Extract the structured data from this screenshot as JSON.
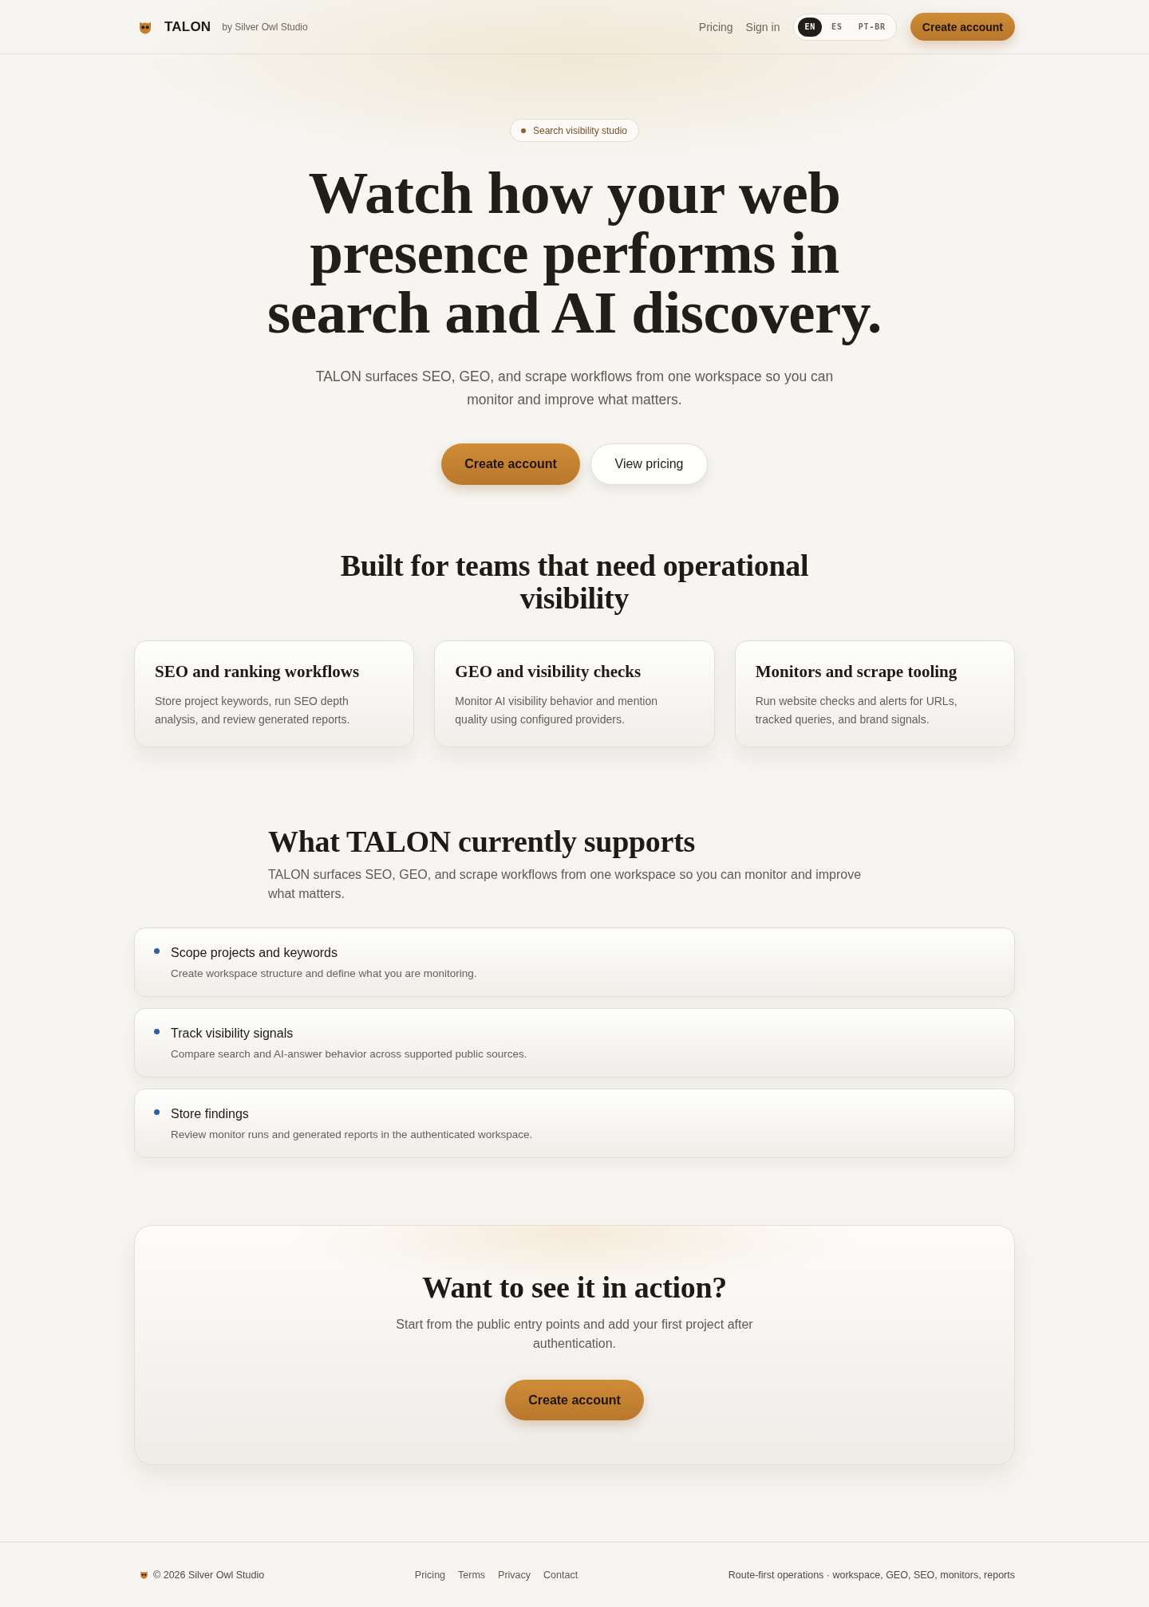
{
  "header": {
    "brand": "TALON",
    "byline": "by Silver Owl Studio",
    "nav_links": [
      "Pricing",
      "Sign in"
    ],
    "languages": [
      {
        "label": "EN",
        "selected": true
      },
      {
        "label": "ES",
        "selected": false
      },
      {
        "label": "PT-BR",
        "selected": false
      }
    ],
    "cta": "Create account"
  },
  "hero": {
    "badge": "Search visibility studio",
    "title": "Watch how your web presence performs in search and AI discovery.",
    "subtitle": "TALON surfaces SEO, GEO, and scrape workflows from one workspace so you can monitor and improve what matters.",
    "buttons": [
      {
        "label": "Create account",
        "kind": "primary"
      },
      {
        "label": "View pricing",
        "kind": "secondary"
      }
    ]
  },
  "features": {
    "heading": "Built for teams that need operational visibility",
    "cards": [
      {
        "title": "SEO and ranking workflows",
        "description": "Store project keywords, run SEO depth analysis, and review generated reports."
      },
      {
        "title": "GEO and visibility checks",
        "description": "Monitor AI visibility behavior and mention quality using configured providers."
      },
      {
        "title": "Monitors and scrape tooling",
        "description": "Run website checks and alerts for URLs, tracked queries, and brand signals."
      }
    ]
  },
  "supports": {
    "heading": "What TALON currently supports",
    "intro": "TALON surfaces SEO, GEO, and scrape workflows from one workspace so you can monitor and improve what matters.",
    "items": [
      {
        "title": "Scope projects and keywords",
        "description": "Create workspace structure and define what you are monitoring."
      },
      {
        "title": "Track visibility signals",
        "description": "Compare search and AI-answer behavior across supported public sources."
      },
      {
        "title": "Store findings",
        "description": "Review monitor runs and generated reports in the authenticated workspace."
      }
    ]
  },
  "cta": {
    "heading": "Want to see it in action?",
    "text": "Start from the public entry points and add your first project after authentication.",
    "button": "Create account"
  },
  "footer": {
    "copyright": "© 2026 Silver Owl Studio",
    "links": [
      "Pricing",
      "Terms",
      "Privacy",
      "Contact"
    ],
    "tagline": "Route-first operations · workspace, GEO, SEO, monitors, reports"
  }
}
